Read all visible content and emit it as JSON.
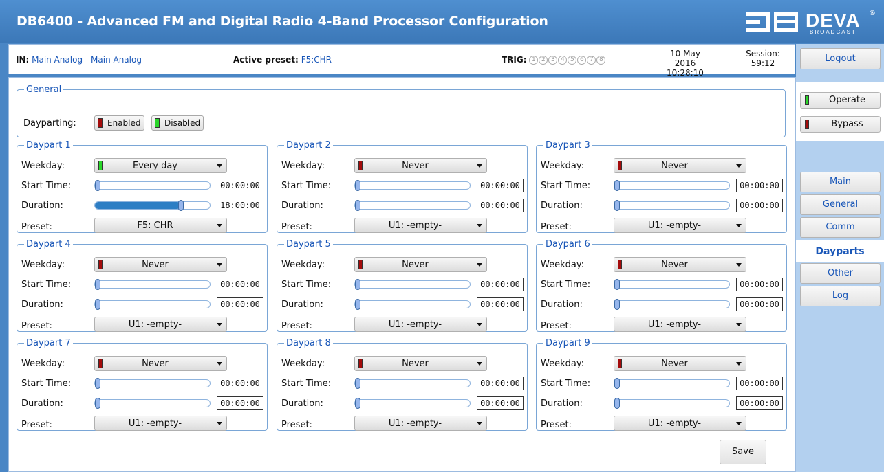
{
  "header": {
    "title": "DB6400 - Advanced FM and Digital Radio 4-Band Processor Configuration",
    "logo_text": "DEVA",
    "logo_sub": "BROADCAST",
    "logo_reg": "®"
  },
  "status": {
    "in_label": "IN:",
    "in_value": "Main Analog - Main Analog",
    "preset_label": "Active preset:",
    "preset_value": "F5:CHR",
    "trig_label": "TRIG:",
    "trig_items": [
      "1",
      "2",
      "3",
      "4",
      "5",
      "6",
      "7",
      "8"
    ],
    "date": "10 May 2016",
    "time": "10:28:10",
    "session_label": "Session:",
    "session_value": "59:12"
  },
  "side": {
    "logout": "Logout",
    "operate": "Operate",
    "bypass": "Bypass",
    "nav": [
      "Main",
      "General",
      "Comm",
      "Dayparts",
      "Other",
      "Log"
    ],
    "active_nav": "Dayparts"
  },
  "general": {
    "legend": "General",
    "dayparting_label": "Dayparting:",
    "enabled": "Enabled",
    "disabled": "Disabled"
  },
  "labels": {
    "weekday": "Weekday:",
    "start": "Start Time:",
    "duration": "Duration:",
    "preset": "Preset:"
  },
  "dayparts": [
    {
      "legend": "Daypart 1",
      "weekday": "Every day",
      "weekday_led": "green",
      "start": "00:00:00",
      "start_pct": 0,
      "duration": "18:00:00",
      "duration_pct": 75,
      "preset": "F5: CHR"
    },
    {
      "legend": "Daypart 2",
      "weekday": "Never",
      "weekday_led": "red",
      "start": "00:00:00",
      "start_pct": 0,
      "duration": "00:00:00",
      "duration_pct": 0,
      "preset": "U1: -empty-"
    },
    {
      "legend": "Daypart 3",
      "weekday": "Never",
      "weekday_led": "red",
      "start": "00:00:00",
      "start_pct": 0,
      "duration": "00:00:00",
      "duration_pct": 0,
      "preset": "U1: -empty-"
    },
    {
      "legend": "Daypart 4",
      "weekday": "Never",
      "weekday_led": "red",
      "start": "00:00:00",
      "start_pct": 0,
      "duration": "00:00:00",
      "duration_pct": 0,
      "preset": "U1: -empty-"
    },
    {
      "legend": "Daypart 5",
      "weekday": "Never",
      "weekday_led": "red",
      "start": "00:00:00",
      "start_pct": 0,
      "duration": "00:00:00",
      "duration_pct": 0,
      "preset": "U1: -empty-"
    },
    {
      "legend": "Daypart 6",
      "weekday": "Never",
      "weekday_led": "red",
      "start": "00:00:00",
      "start_pct": 0,
      "duration": "00:00:00",
      "duration_pct": 0,
      "preset": "U1: -empty-"
    },
    {
      "legend": "Daypart 7",
      "weekday": "Never",
      "weekday_led": "red",
      "start": "00:00:00",
      "start_pct": 0,
      "duration": "00:00:00",
      "duration_pct": 0,
      "preset": "U1: -empty-"
    },
    {
      "legend": "Daypart 8",
      "weekday": "Never",
      "weekday_led": "red",
      "start": "00:00:00",
      "start_pct": 0,
      "duration": "00:00:00",
      "duration_pct": 0,
      "preset": "U1: -empty-"
    },
    {
      "legend": "Daypart 9",
      "weekday": "Never",
      "weekday_led": "red",
      "start": "00:00:00",
      "start_pct": 0,
      "duration": "00:00:00",
      "duration_pct": 0,
      "preset": "U1: -empty-"
    }
  ],
  "save": "Save",
  "colors": {
    "accent": "#1a57b8",
    "titlebar": "#3c78b8",
    "led_red": "#a40c0c",
    "led_green": "#2ad62a",
    "slider_fill": "#2d7ec4"
  }
}
